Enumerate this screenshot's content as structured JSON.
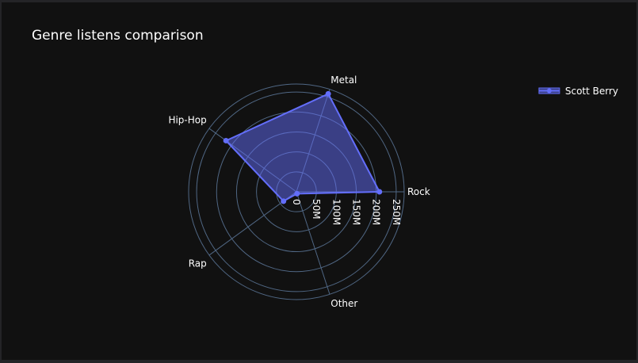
{
  "chart_data": {
    "type": "radar",
    "title": "Genre listens comparison",
    "categories": [
      "Rock",
      "Metal",
      "Hip-Hop",
      "Rap",
      "Other"
    ],
    "series": [
      {
        "name": "Scott Berry",
        "values": [
          208000000,
          258000000,
          218000000,
          40000000,
          5000000
        ],
        "color": "#636efa"
      }
    ],
    "radial_axis": {
      "range": [
        0,
        270000000
      ],
      "tick_values": [
        0,
        50000000,
        100000000,
        150000000,
        200000000,
        250000000
      ],
      "tick_labels": [
        "0",
        "50M",
        "100M",
        "150M",
        "200M",
        "250M"
      ]
    },
    "grid": true,
    "legend_position": "top-right"
  },
  "colors": {
    "page_background": "#242427",
    "plot_background": "#111111",
    "grid": "#506784",
    "series_line": "#636efa",
    "series_fill": "rgba(99,110,250,0.5)"
  }
}
